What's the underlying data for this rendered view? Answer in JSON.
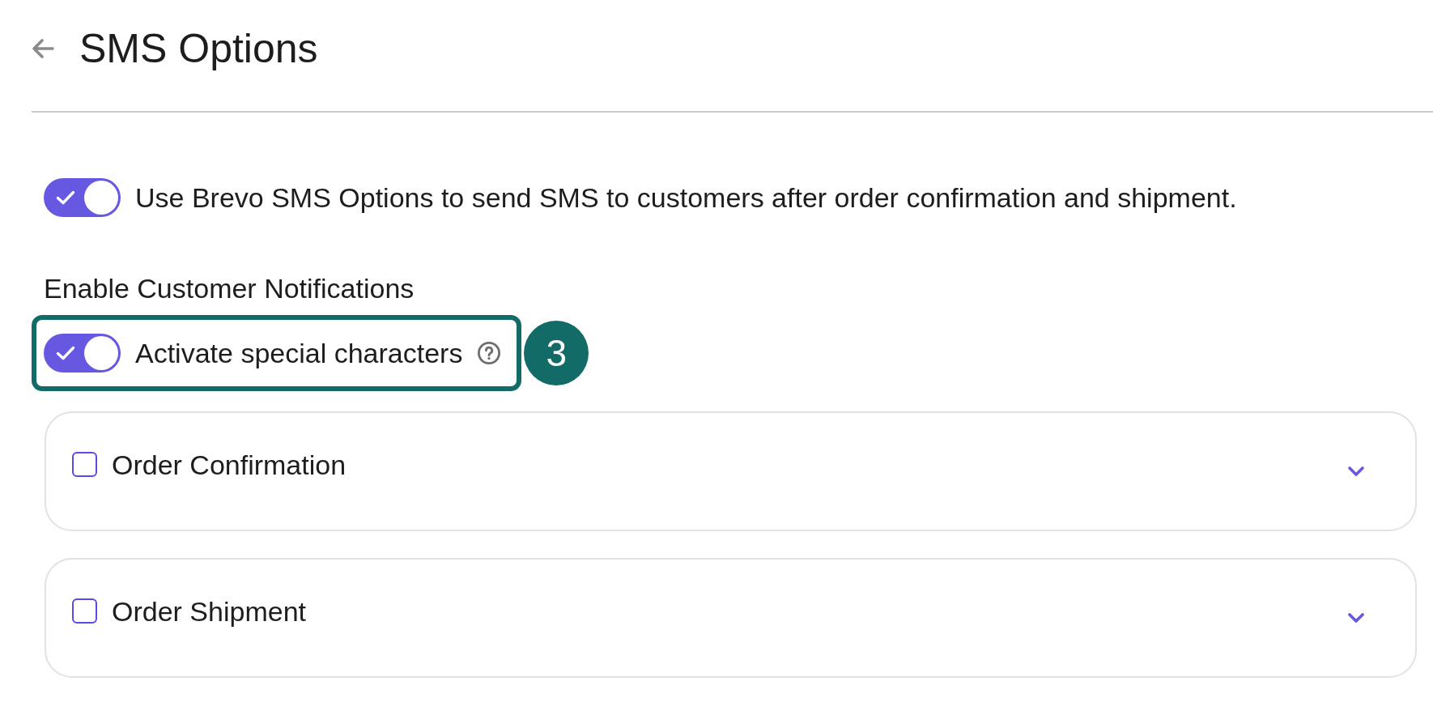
{
  "header": {
    "title": "SMS Options"
  },
  "main_toggle": {
    "label": "Use Brevo SMS Options to send SMS to customers after order confirmation and shipment.",
    "on": true
  },
  "section_title": "Enable Customer Notifications",
  "special_characters": {
    "label": "Activate special characters",
    "on": true,
    "highlighted": true,
    "callout": "3"
  },
  "notifications": [
    {
      "label": "Order Confirmation",
      "checked": false,
      "expanded": false
    },
    {
      "label": "Order Shipment",
      "checked": false,
      "expanded": false
    }
  ]
}
